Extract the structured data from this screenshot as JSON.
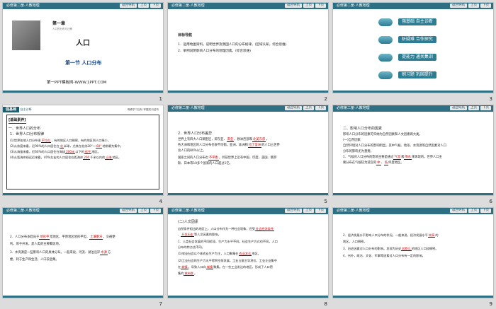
{
  "header": {
    "title": "必修第二册·人教地理",
    "nav": "返回导航",
    "up": "上页",
    "down": "下页"
  },
  "s1": {
    "chapter": "第一章",
    "chapter_sub": "人口的分布与迁移",
    "title": "人口",
    "section": "第一节  人口分布",
    "footer": "第一PPT模板网-WWW.1PPT.COM",
    "num": "1"
  },
  "s2": {
    "head": "目标导航",
    "l1": "1．运用地图资料，说明世界及我国人口的分布规律。(区域认知，综合思维)",
    "l2": "2．举例说明影响人口分布的地理因素。(综合思维)",
    "num": "2"
  },
  "s3": {
    "items": [
      "强基础 自主诊断",
      "析疑难 合作探究",
      "提能力 通关集训",
      "刷习题 巩固提升"
    ],
    "num": "3"
  },
  "s4": {
    "band": "强基础",
    "band_sub": "自主诊断",
    "band_right": "明确学习目标  掌握知识结构",
    "h": "[基础素养]",
    "a": "一、世界人口的分布",
    "b": "1．世界人口分布规律",
    "c": "(1)世界各地人口分布很",
    "c_fill": "不均匀",
    "c2": "，有的地区人口稠密，有的地区则人口稀少。",
    "d": "(2)从纬度来看，近90%的人口居住在",
    "d_fill": "北",
    "d2": "半球，尤其在北纬20°～",
    "d_fill2": "60°",
    "d3": "地带最为集中。",
    "e": "(3)从海拔来看，近60%的人口居住在海拔",
    "e_fill": "200米",
    "e2": "以下的",
    "e_fill2": "低平",
    "e3": "地区。",
    "f": "(4)从距海岸线远近来看，40%左右的人口居住在距海岸",
    "f_fill": "200",
    "f2": "千米以内的",
    "f_fill2": "沿海",
    "f3": "地区。",
    "num": "4"
  },
  "s5": {
    "a": "2．世界人口分布差异",
    "b": "世界上有四大人口稠密区，即东亚、",
    "b_fill": "南亚",
    "b2": "、欧洲西部和",
    "b_fill2": "北美东部",
    "b3": "，",
    "c": "各大洲和地区的人口分布也很不均衡。亚洲、非洲和",
    "c_fill": "拉丁美洲",
    "c2": "的人口占世界",
    "d": "总人口的80%以上。",
    "e": "国家之间的人口分布也",
    "e_fill": "不平衡",
    "e2": "，目前世界上近有中国、印度、美国、俄罗",
    "f": "斯、日本等10多个国家的人口超过1亿。",
    "num": "5"
  },
  "s6": {
    "a": "二、影响人口分布的因素",
    "b": "影响人口分布的因素可归纳为自然因素和人文因素两大类。",
    "c": "(一)自然因素",
    "d": "自然环境对人口分布的影响明显。其中气候、地形、水资源等自然因素对人口",
    "e": "分布的影响尤为重要。",
    "f": "1．气候对人口分布的影响主要是通过",
    "f_fill": "气温",
    "f2": "和",
    "f_fill2": "降水",
    "f3": "来体现的。世界人口主",
    "g": "要分布在气候较为适宜的",
    "g_fill": "中",
    "g2": "、",
    "g_fill2": "低",
    "g3": "纬度地区。",
    "num": "6"
  },
  "s7": {
    "a": "2．人口分布多趋向于",
    "a_fill": "地形平",
    "a2": "坦地区，平原地区地形平坦，",
    "a_fill2": "土壤肥沃",
    "a3": "，交通便",
    "b": "利，易于开发，是人类的主要聚居地。",
    "c": "3．水资源是一些影响人口的具体分布。一般来说，河流、湖泊沿岸",
    "c_fill": "水源",
    "c2": "方",
    "d": "便，利于生产和生活，人口较密集。",
    "num": "7"
  },
  "s8": {
    "a": "(二)人文因素",
    "b": "自然条件相当的地区上，人口分布作为一种社会现象，还受",
    "b_fill": "社会经济条件",
    "c": "、",
    "c_fill": "开发历史",
    "c2": "等人文因素的影响。",
    "d": "1．人类社会发展的不同阶段，生产力水平不同，社会生产方式也不同，人口",
    "e": "分布的特点也不同。",
    "f": "(1)农业社会以个体农业生产为主，人口聚集在",
    "f_fill": "农业发达",
    "f2": "地区。",
    "g": "(2)工业社会的生产力水平得到空前发展，工业占据主导地位，工业企业集中",
    "h": "在",
    "h_fill": "城镇",
    "h2": "，导致人口向",
    "h_fill2": "城镇",
    "h3": "聚集。在一些工业发达的地区，形成了人口密",
    "i": "集的",
    "i_fill": "城市群",
    "i2": "。",
    "num": "8"
  },
  "s9": {
    "a": "2．经济发展水平影响人口分布的状况。一般来说，经济发展水平",
    "a_fill": "较高",
    "a2": "的",
    "b": "地区，人口稠密。",
    "c": "3．历史因素对人口分布的影响。发现为历史",
    "c_fill": "较悠久",
    "c2": "的地区人口较稠密。",
    "d": "4．另外，政治、文化、军事等因素对人口分布有一定的影响。",
    "num": "9"
  },
  "colors": {
    "header": "#2f6f83",
    "accent_red": "#c00000",
    "pill": "#2c7d94"
  }
}
